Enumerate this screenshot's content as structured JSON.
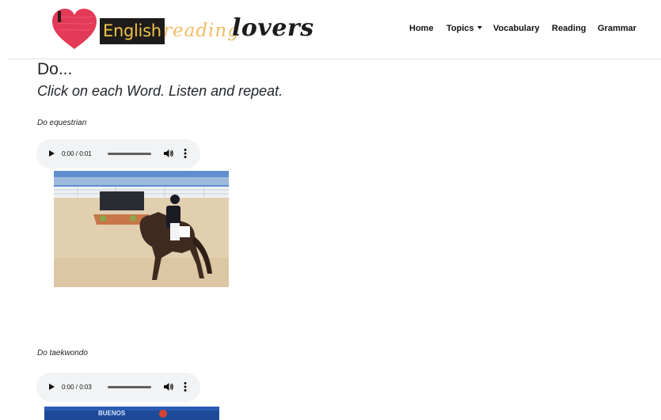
{
  "site": {
    "logo": {
      "word1": "English",
      "word2": "reading",
      "word3": "lovers"
    },
    "nav": {
      "home": "Home",
      "topics": "Topics",
      "vocabulary": "Vocabulary",
      "reading": "Reading",
      "grammar": "Grammar"
    }
  },
  "page": {
    "title": "Do...",
    "subtitle": "Click on each Word. Listen and repeat."
  },
  "items": [
    {
      "label": "Do equestrian",
      "audio_time": "0:00 / 0:01"
    },
    {
      "label": "Do taekwondo",
      "audio_time": "0:00 / 0:03",
      "photo_text": "BUENOS"
    }
  ],
  "colors": {
    "heart": "#e23a57",
    "logo_yellow": "#f0c24a",
    "audio_bg": "#f1f3f4"
  }
}
